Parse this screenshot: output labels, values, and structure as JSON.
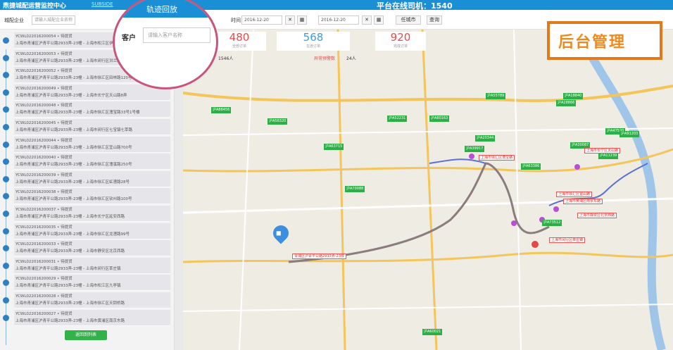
{
  "header": {
    "app_title": "鼎捷城配运营监控中心",
    "link_text": "SUBSIDE",
    "online_drivers": "平台在线司机：1540"
  },
  "filters": {
    "enterprise_label": "城配企业",
    "enterprise_placeholder": "请输入城配企业名称",
    "time_label": "时间",
    "date_start": "2016-12-20",
    "date_end": "2016-12-20",
    "clear_symbol": "✕",
    "city_select": "任城市",
    "query_button": "查询"
  },
  "stats": [
    {
      "value": "480",
      "caption": "全部订单",
      "color": "#e84a4a"
    },
    {
      "value": "568",
      "caption": "在途订单",
      "color": "#3b9be0"
    },
    {
      "value": "920",
      "caption": "完成订单",
      "color": "#e84a4a"
    }
  ],
  "info": {
    "people": "1546人",
    "warning_label": "异常预警数",
    "warning_value": "24人"
  },
  "popup": {
    "title": "轨迹回放",
    "customer_label": "客户",
    "customer_placeholder": "请输入客户名称"
  },
  "admin": {
    "label": "后台管理"
  },
  "sidebar": {
    "company_label": "城配企业",
    "company_placeholder": "请输入城配企业名称",
    "side_button": "查询",
    "bottom_button": "返回到列表",
    "orders": [
      {
        "code": "YCWL022016200054 • 待提货",
        "addr": "上海市青浦区沪青平公路2933弄-23幢 - 上海市松江区伊珊路188号"
      },
      {
        "code": "YCWL022016200053 • 待提货",
        "addr": "上海市青浦区沪青平公路2933弄-23幢 - 上海市闵行区洪兰路26号"
      },
      {
        "code": "YCWL022016200052 • 待提货",
        "addr": "上海市青浦区沪青平公路2933弄-23幢 - 上海市徐汇区田林路120号"
      },
      {
        "code": "YCWL022016200049 • 待提货",
        "addr": "上海市青浦区沪青平公路2933弄-23幢 - 上海市长宁区天山路8弄"
      },
      {
        "code": "YCWL022016200048 • 待提货",
        "addr": "上海市青浦区沪青平公路2933弄-23幢 - 上海市徐汇区漕宝路33号1号楼"
      },
      {
        "code": "YCWL022016200045 • 待提货",
        "addr": "上海市青浦区沪青平公路2933弄-23幢 - 上海市闵行区七宝镇七莘路"
      },
      {
        "code": "YCWL022016200044 • 待提货",
        "addr": "上海市青浦区沪青平公路2933弄-23幢 - 上海市徐汇区宜山路700号"
      },
      {
        "code": "YCWL022016200040 • 待提货",
        "addr": "上海市青浦区沪青平公路2933弄-23幢 - 上海市徐汇区漕溪路250号"
      },
      {
        "code": "YCWL022016200039 • 待提货",
        "addr": "上海市青浦区沪青平公路2933弄-23幢 - 上海市徐汇区虹漕路28号"
      },
      {
        "code": "YCWL022016200038 • 待提货",
        "addr": "上海市青浦区沪青平公路2933弄-23幢 - 上海市徐汇区钦州路100号"
      },
      {
        "code": "YCWL022016200037 • 待提货",
        "addr": "上海市青浦区沪青平公路2933弄-23幢 - 上海市长宁区延安西路"
      },
      {
        "code": "YCWL022016200035 • 待提货",
        "addr": "上海市青浦区沪青平公路2933弄-23幢 - 上海市徐汇区龙漕路99号"
      },
      {
        "code": "YCWL022016200033 • 待提货",
        "addr": "上海市青浦区沪青平公路2933弄-23幢 - 上海市静安区北京西路"
      },
      {
        "code": "YCWL022016200031 • 待提货",
        "addr": "上海市青浦区沪青平公路2933弄-23幢 - 上海市闵行区莘庄镇"
      },
      {
        "code": "YCWL022016200029 • 待提货",
        "addr": "上海市青浦区沪青平公路2933弄-23幢 - 上海市松江区九亭镇"
      },
      {
        "code": "YCWL022016200028 • 待提货",
        "addr": "上海市青浦区沪青平公路2933弄-23幢 - 上海市徐汇区天钥桥路"
      },
      {
        "code": "YCWL022016200027 • 待提货",
        "addr": "上海市青浦区沪青平公路2933弄-23幢 - 上海市黄浦区南京东路"
      }
    ]
  },
  "map": {
    "green_tags": [
      "沪A88456",
      "沪A56320",
      "沪A63715",
      "沪A70088",
      "沪A52231",
      "沪A80163",
      "沪A55789",
      "沪A20344",
      "沪A39917",
      "沪A63386",
      "沪A18840",
      "沪A47520",
      "沪A91203",
      "沪A30087",
      "沪A73512",
      "沪A28866",
      "沪A60021",
      "沪A11239"
    ],
    "red_tags": [
      "青浦区沪青平公路2933弄-23幢",
      "上海市徐汇区漕宝路",
      "上海市长宁区天山路",
      "上海市静安区北京西路",
      "上海市黄浦区南京东路",
      "上海市闵行区莘庄镇",
      "上海市徐汇区宜山路"
    ]
  }
}
